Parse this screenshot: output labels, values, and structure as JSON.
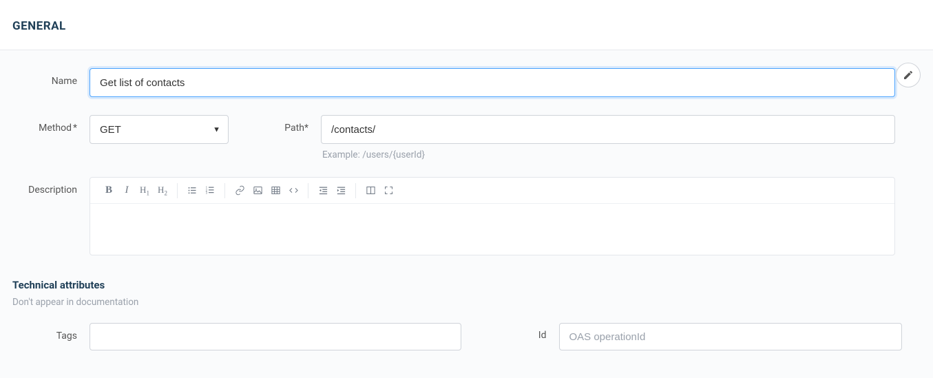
{
  "header": {
    "title": "GENERAL"
  },
  "form": {
    "name": {
      "label": "Name",
      "value": "Get list of contacts"
    },
    "method": {
      "label": "Method",
      "required": "*",
      "value": "GET"
    },
    "path": {
      "label": "Path",
      "required": "*",
      "value": "/contacts/",
      "hint": "Example: /users/{userId}"
    },
    "description": {
      "label": "Description",
      "value": ""
    }
  },
  "tech": {
    "title": "Technical attributes",
    "subtitle": "Don't appear in documentation",
    "tags": {
      "label": "Tags",
      "value": ""
    },
    "id": {
      "label": "Id",
      "placeholder": "OAS operationId",
      "value": ""
    }
  }
}
